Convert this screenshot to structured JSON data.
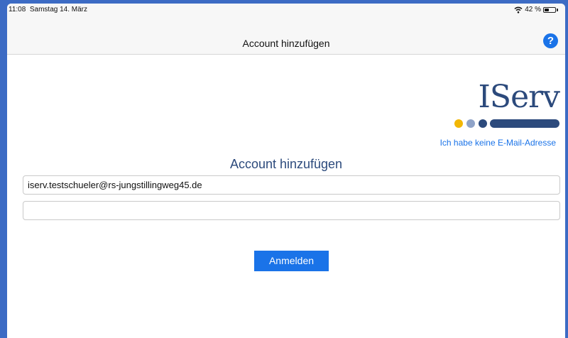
{
  "status": {
    "time": "11:08",
    "date": "Samstag 14. März",
    "battery": "42 %",
    "battery_level": 0.42
  },
  "nav": {
    "title": "Account hinzufügen",
    "help_label": "?"
  },
  "logo": {
    "text": "IServ",
    "dot_colors": [
      "#f2b705",
      "#8fa3c8",
      "#2c4a7c"
    ]
  },
  "links": {
    "no_email": "Ich habe keine E-Mail-Adresse"
  },
  "form": {
    "title": "Account hinzufügen",
    "account_value": "iserv.testschueler@rs-jungstillingweg45.de",
    "password_value": "",
    "login_label": "Anmelden"
  },
  "colors": {
    "accent": "#1a73e8",
    "brand": "#2c4a7c"
  }
}
